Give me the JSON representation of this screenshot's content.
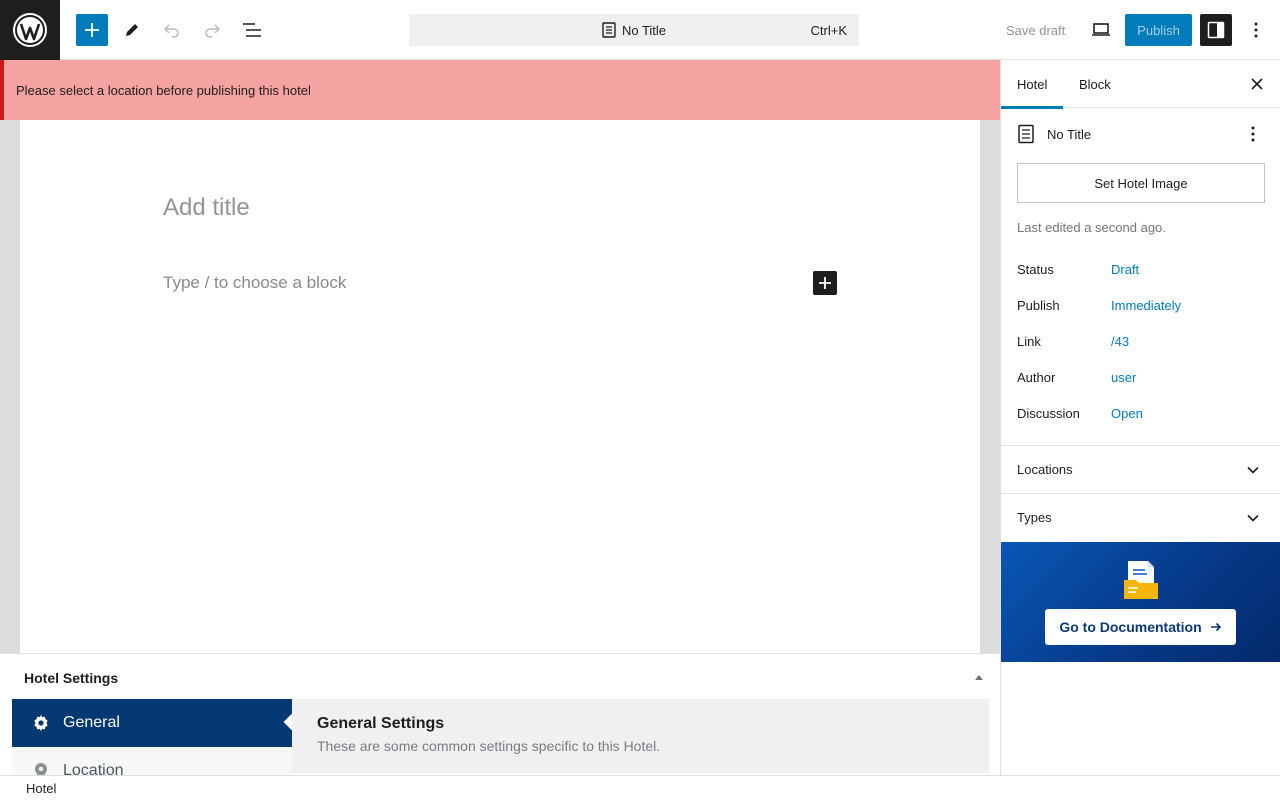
{
  "toolbar": {
    "wp_logo": "wordpress-logo",
    "command_title": "No Title",
    "command_shortcut": "Ctrl+K",
    "save_draft": "Save draft",
    "publish": "Publish"
  },
  "notice": {
    "text": "Please select a location before publishing this hotel"
  },
  "editor": {
    "title_placeholder": "Add title",
    "block_placeholder": "Type / to choose a block"
  },
  "metabox": {
    "title": "Hotel Settings",
    "nav": [
      {
        "label": "General",
        "icon": "gear-icon",
        "active": true
      },
      {
        "label": "Location",
        "icon": "location-pin-icon",
        "active": false
      }
    ],
    "content_title": "General Settings",
    "content_desc": "These are some common settings specific to this Hotel."
  },
  "footer": {
    "breadcrumb": "Hotel"
  },
  "sidebar": {
    "tabs": [
      "Hotel",
      "Block"
    ],
    "doc_title": "No Title",
    "set_image": "Set Hotel Image",
    "last_edited": "Last edited a second ago.",
    "meta": [
      {
        "label": "Status",
        "value": "Draft"
      },
      {
        "label": "Publish",
        "value": "Immediately"
      },
      {
        "label": "Link",
        "value": "/43"
      },
      {
        "label": "Author",
        "value": "user"
      },
      {
        "label": "Discussion",
        "value": "Open"
      }
    ],
    "panels": [
      "Locations",
      "Types"
    ],
    "promo_button": "Go to Documentation"
  },
  "colors": {
    "accent": "#007cba",
    "notice_bg": "#f4a2a2",
    "notice_border": "#cc1818",
    "metabox_nav_active": "#043873"
  }
}
